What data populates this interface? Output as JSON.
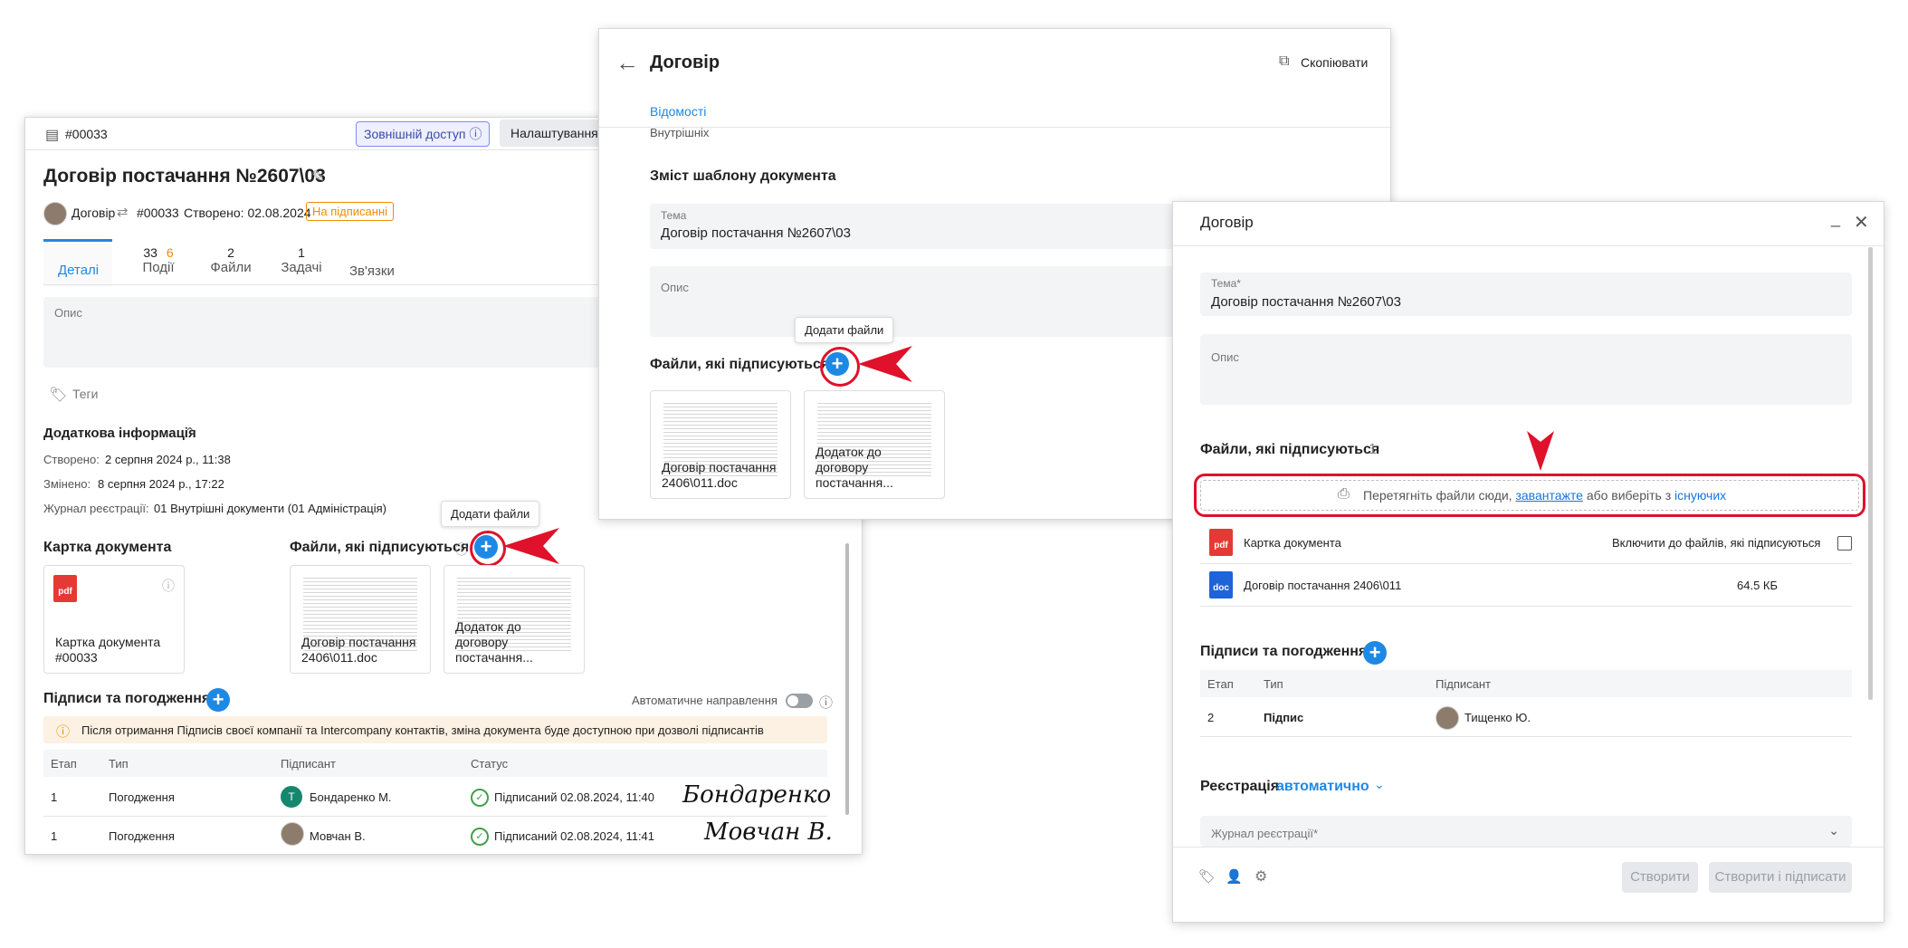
{
  "left": {
    "doc_id": "#00033",
    "external_access": "Зовнішній доступ",
    "settings": "Налаштування д",
    "title": "Договір постачання №2607\\03",
    "meta_type": "Договір",
    "meta_id": "#00033",
    "meta_created": "Створено: 02.08.2024",
    "status": "На підписанні",
    "tabs": [
      {
        "count": "",
        "label": "Деталі"
      },
      {
        "count": "33",
        "count2": "6",
        "label": "Події"
      },
      {
        "count": "2",
        "label": "Файли"
      },
      {
        "count": "1",
        "label": "Задачі"
      },
      {
        "count": "",
        "label": "Зв'язки"
      }
    ],
    "description_label": "Опис",
    "tags": "Теги",
    "extra_info": "Додаткова інформація",
    "created_label": "Створено:",
    "created_value": "2 серпня 2024 р., 11:38",
    "changed_label": "Змінено:",
    "changed_value": "8 серпня 2024 р., 17:22",
    "journal_label": "Журнал реєстрації:",
    "journal_value": "01 Внутрішні документи (01 Адміністрація)",
    "card_title": "Картка документа",
    "card_caption": "Картка документа #00033",
    "files_title": "Файли, які підписуються",
    "add_files_tip": "Додати файли",
    "file1": "Договір постачання 2406\\011.doc",
    "file2": "Додаток до договору постачання...",
    "signatures_title": "Підписи та погодження",
    "auto_direction": "Автоматичне направлення",
    "warning": "Після отримання Підписів своєї компанії та Intercompany контактів, зміна документа буде доступною при дозволі підписантів",
    "table_headers": [
      "Етап",
      "Тип",
      "Підписант",
      "Статус"
    ],
    "rows": [
      {
        "stage": "1",
        "type": "Погодження",
        "avatar": "Т",
        "signer": "Бондаренко М.",
        "status": "Підписаний 02.08.2024, 11:40",
        "signature": "Бондаренко"
      },
      {
        "stage": "1",
        "type": "Погодження",
        "avatar": "",
        "signer": "Мовчан В.",
        "status": "Підписаний 02.08.2024, 11:41",
        "signature": "Мовчан В."
      }
    ]
  },
  "middle": {
    "title": "Договір",
    "copy": "Скопіювати",
    "tab": "Відомості",
    "cut_text": "Внутрішніх",
    "template_title": "Зміст шаблону документа",
    "theme_label": "Тема",
    "theme_value": "Договір постачання №2607\\03",
    "description_label": "Опис",
    "add_files_tip": "Додати файли",
    "files_title": "Файли, які підписуються",
    "file1": "Договір постачання 2406\\011.doc",
    "file2": "Додаток до договору постачання..."
  },
  "right": {
    "title": "Договір",
    "theme_label": "Тема*",
    "theme_value": "Договір постачання №2607\\03",
    "description_label": "Опис",
    "files_title": "Файли, які підписуються",
    "files_count": "1",
    "drop_text_1": "Перетягніть файли сюди,",
    "drop_link_1": "завантажте",
    "drop_text_2": "або виберіть з",
    "drop_link_2": "існуючих",
    "file_card": "Картка документа",
    "include_label": "Включити до файлів, які підписуються",
    "file_doc": "Договір постачання 2406\\011",
    "file_doc_size": "64.5 КБ",
    "signatures_title": "Підписи та погодження",
    "table_headers": [
      "Етап",
      "Тип",
      "Підписант"
    ],
    "row": {
      "stage": "2",
      "type": "Підпис",
      "signer": "Тищенко Ю."
    },
    "registration_label": "Реєстрація",
    "registration_mode": "автоматично",
    "journal_label": "Журнал реєстрації*",
    "btn_create": "Створити",
    "btn_create_sign": "Створити і підписати"
  },
  "colors": {
    "accent": "#1e88e5",
    "marker": "#e0112b",
    "status_orange": "#f08c00"
  }
}
